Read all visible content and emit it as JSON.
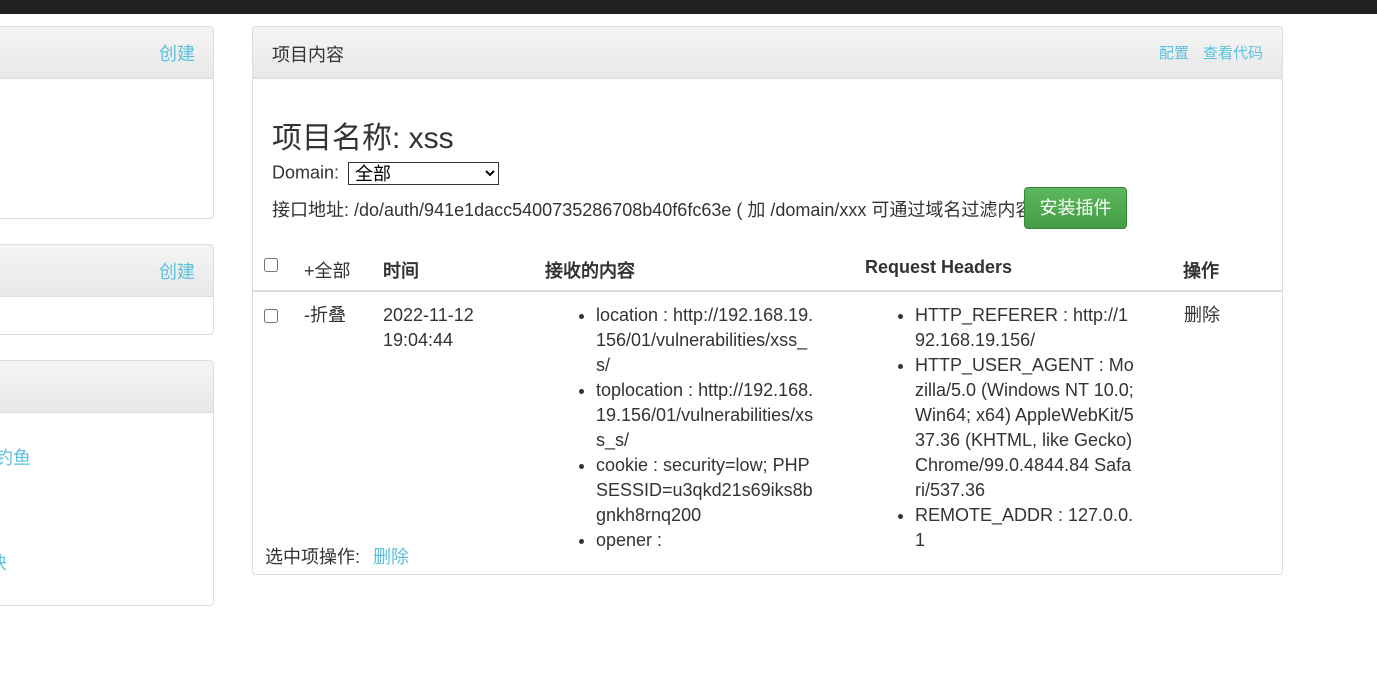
{
  "left_panels": {
    "panel1": {
      "create_label": "创建"
    },
    "panel2": {
      "create_label": "创建"
    },
    "panel3": {
      "item1": "钓鱼",
      "item2": "块"
    }
  },
  "main": {
    "title": "项目内容",
    "config_link": "配置",
    "view_code_link": "查看代码",
    "project_name_label": "项目名称: xss",
    "domain_label": "Domain:",
    "domain_selected": "全部",
    "api_label": "接口地址: /do/auth/941e1dacc5400735286708b40f6fc63e ( 加 /domain/xxx 可通过域名过滤内容)",
    "install_button": "安装插件",
    "table": {
      "headers": {
        "toggle_all": "+全部",
        "time": "时间",
        "content": "接收的内容",
        "request_headers": "Request Headers",
        "actions": "操作"
      },
      "rows": [
        {
          "toggle": "-折叠",
          "time": "2022-11-12 19:04:44",
          "content": [
            "location : http://192.168.19.156/01/vulnerabilities/xss_s/",
            "toplocation : http://192.168.19.156/01/vulnerabilities/xss_s/",
            "cookie : security=low; PHPSESSID=u3qkd21s69iks8bgnkh8rnq200",
            "opener :"
          ],
          "headers": [
            "HTTP_REFERER : http://192.168.19.156/",
            "HTTP_USER_AGENT : Mozilla/5.0 (Windows NT 10.0; Win64; x64) AppleWebKit/537.36 (KHTML, like Gecko) Chrome/99.0.4844.84 Safari/537.36",
            "REMOTE_ADDR : 127.0.0.1"
          ],
          "delete_label": "删除"
        }
      ]
    },
    "selected_ops_label": "选中项操作:",
    "selected_delete": "删除"
  }
}
